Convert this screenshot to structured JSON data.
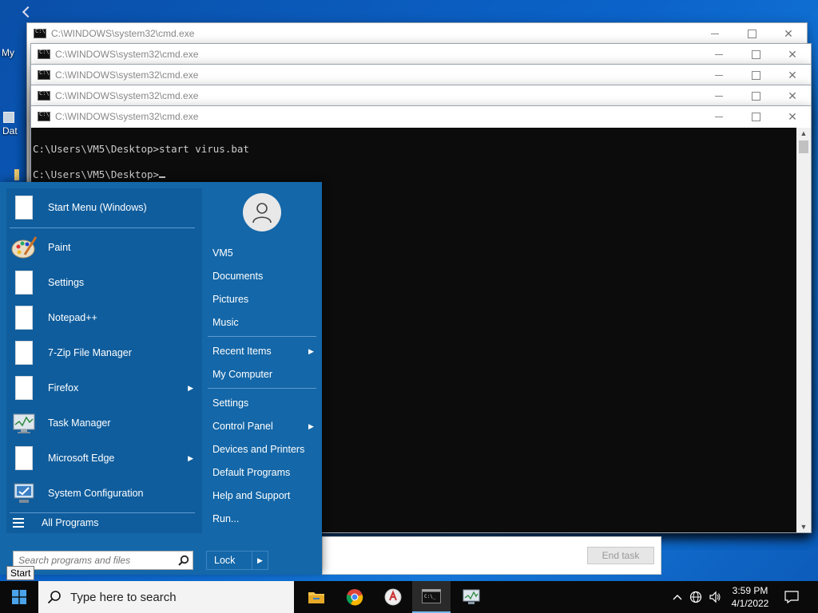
{
  "desktop": {
    "frag_my": "My",
    "frag_dat": "Dat"
  },
  "cmd_windows": [
    {
      "title": "C:\\WINDOWS\\system32\\cmd.exe"
    },
    {
      "title": "C:\\WINDOWS\\system32\\cmd.exe"
    },
    {
      "title": "C:\\WINDOWS\\system32\\cmd.exe"
    },
    {
      "title": "C:\\WINDOWS\\system32\\cmd.exe"
    },
    {
      "title": "C:\\WINDOWS\\system32\\cmd.exe"
    }
  ],
  "console": {
    "line1": "C:\\Users\\VM5\\Desktop>start virus.bat",
    "line2": "C:\\Users\\VM5\\Desktop>"
  },
  "task_dialog": {
    "end_task": "End task"
  },
  "start_menu": {
    "pinned": [
      {
        "label": "Start Menu (Windows)",
        "icon": "document-icon"
      },
      {
        "label": "Paint",
        "icon": "paint-icon"
      },
      {
        "label": "Settings",
        "icon": "document-icon"
      },
      {
        "label": "Notepad++",
        "icon": "document-icon"
      },
      {
        "label": "7-Zip File Manager",
        "icon": "document-icon"
      },
      {
        "label": "Firefox",
        "icon": "document-icon"
      },
      {
        "label": "Task Manager",
        "icon": "task-manager-icon"
      },
      {
        "label": "Microsoft Edge",
        "icon": "document-icon"
      },
      {
        "label": "System Configuration",
        "icon": "system-config-icon"
      }
    ],
    "all_programs": "All Programs",
    "search_placeholder": "Search programs and files",
    "right": {
      "user": "VM5",
      "documents": "Documents",
      "pictures": "Pictures",
      "music": "Music",
      "recent_items": "Recent Items",
      "my_computer": "My Computer",
      "settings": "Settings",
      "control_panel": "Control Panel",
      "devices_printers": "Devices and Printers",
      "default_programs": "Default Programs",
      "help_support": "Help and Support",
      "run": "Run..."
    },
    "lock": "Lock",
    "tooltip": "Start"
  },
  "taskbar": {
    "search_text": "Type here to search",
    "time": "3:59 PM",
    "date": "4/1/2022",
    "accent": "#76b9ed"
  }
}
